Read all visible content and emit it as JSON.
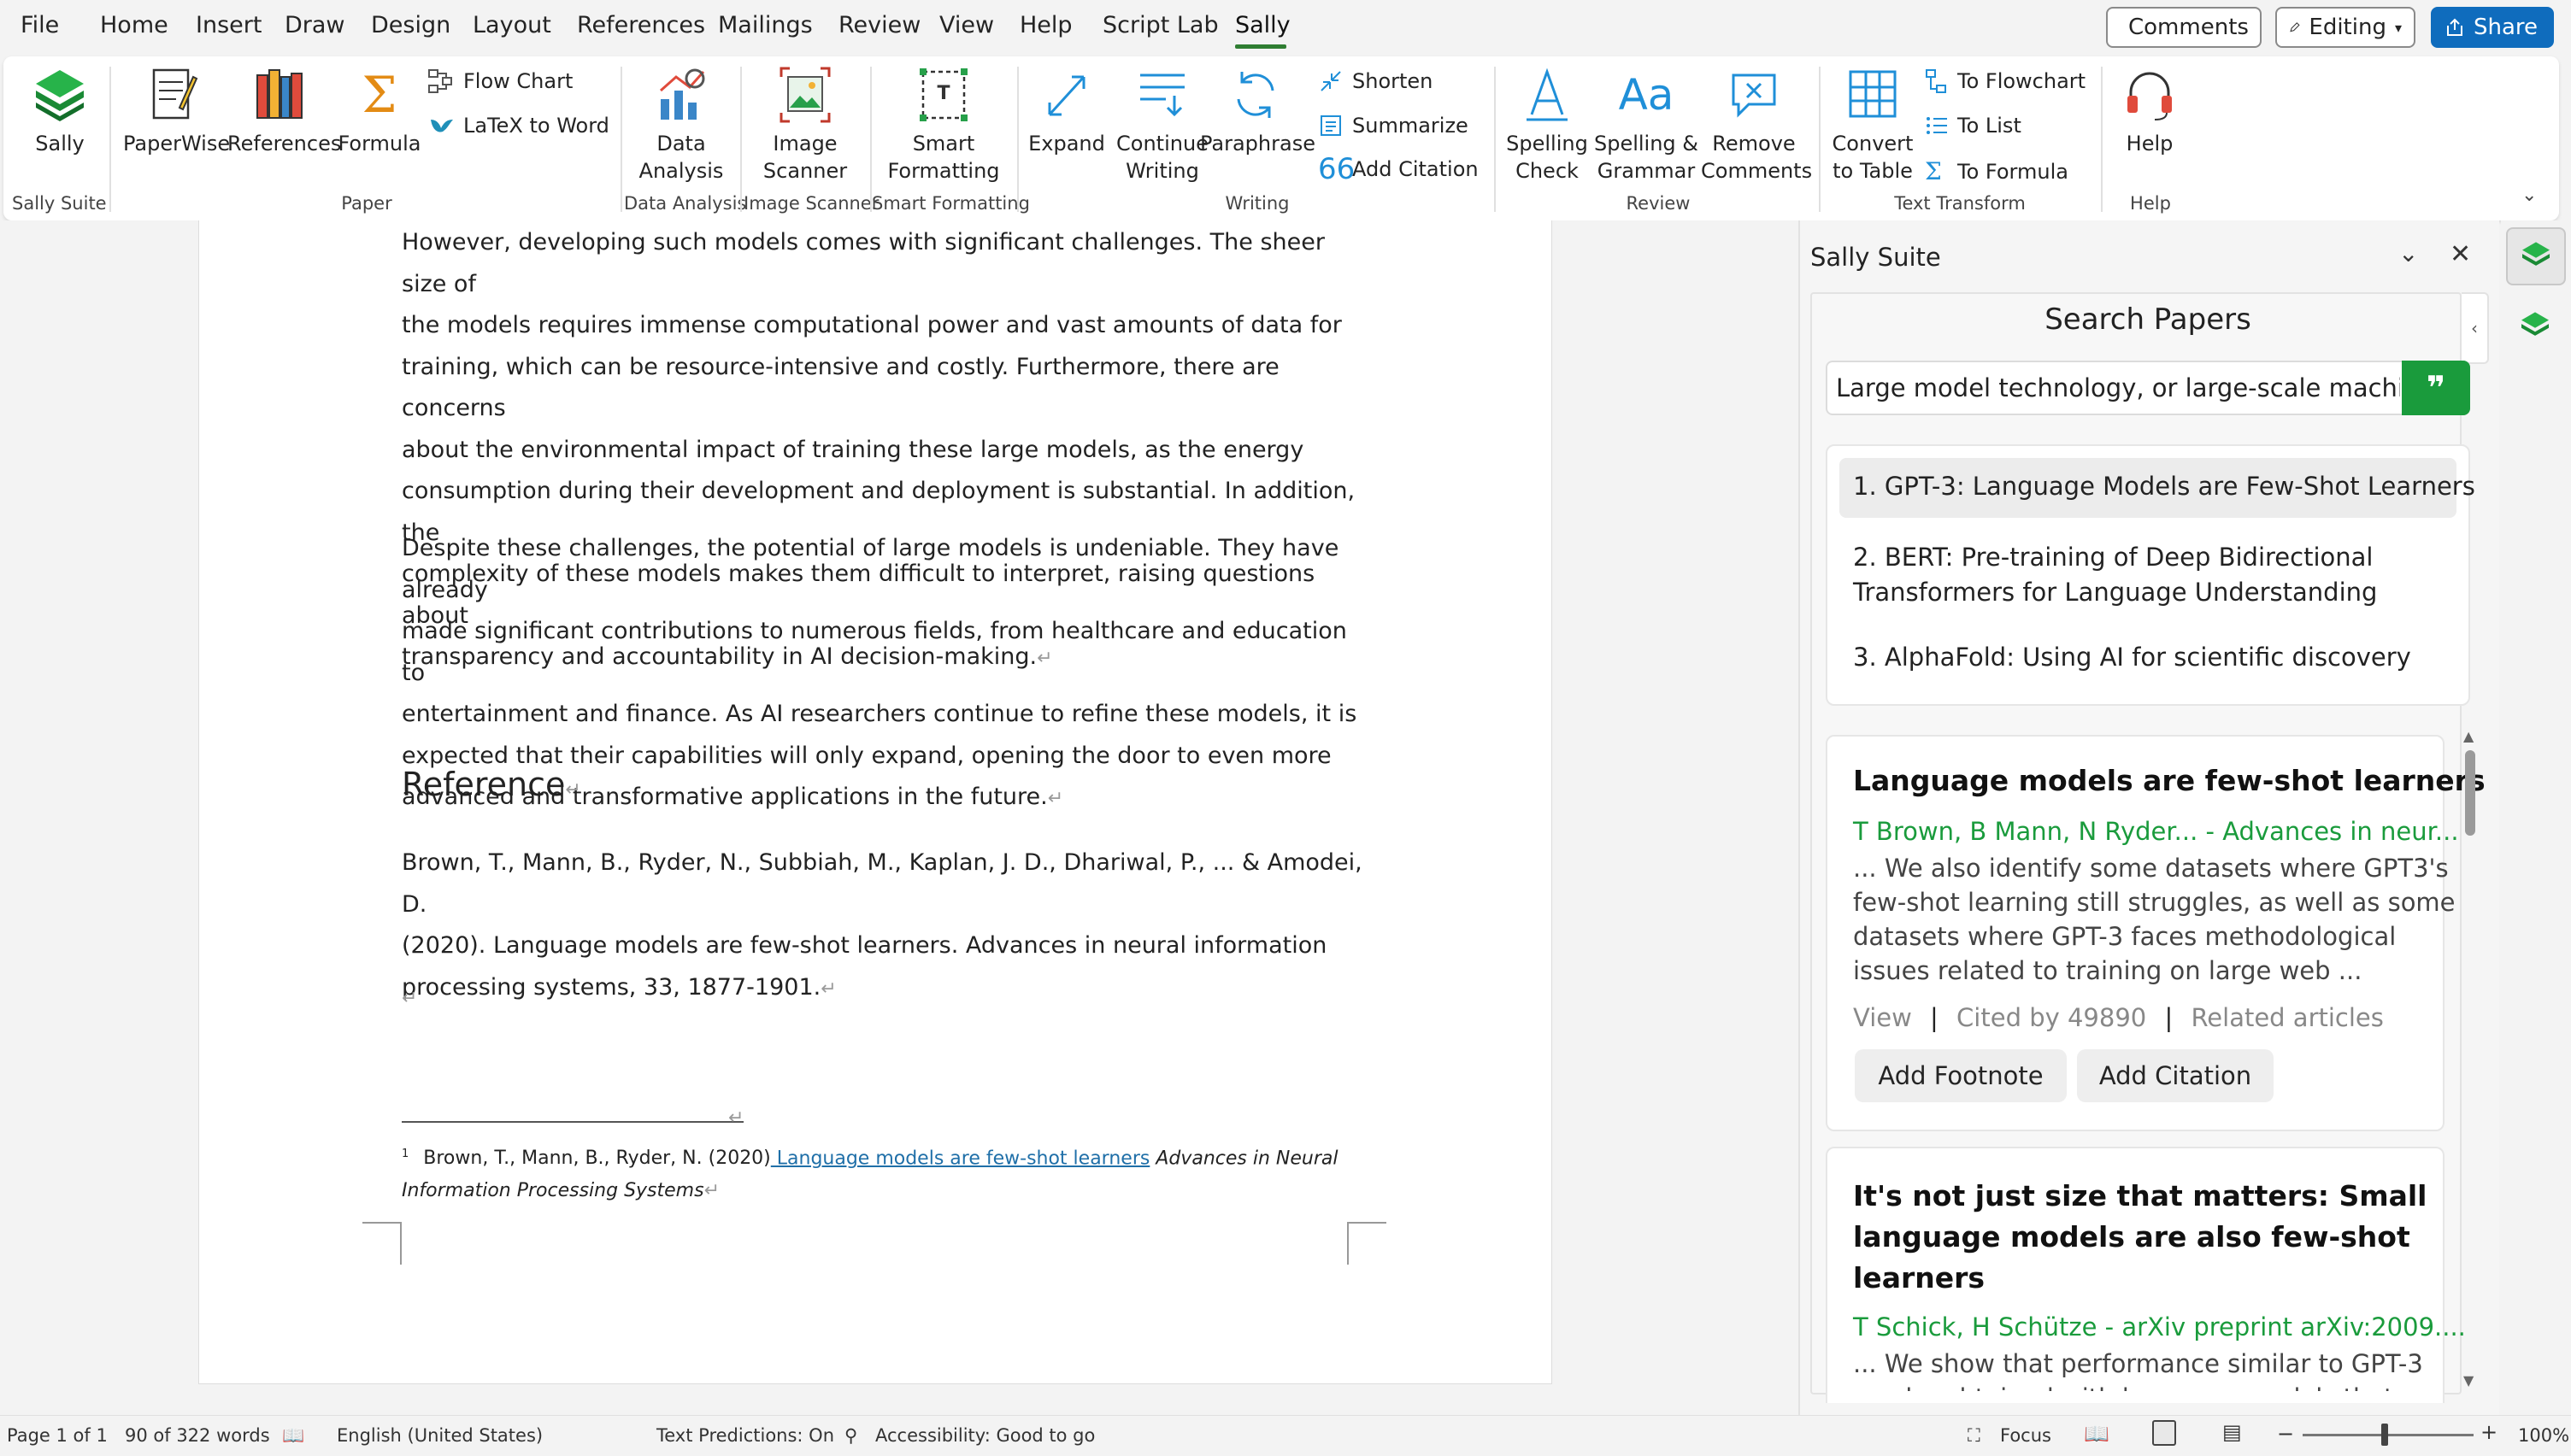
{
  "menubar": {
    "items": [
      "File",
      "Home",
      "Insert",
      "Draw",
      "Design",
      "Layout",
      "References",
      "Mailings",
      "Review",
      "View",
      "Help",
      "Script Lab",
      "Sally"
    ],
    "active": "Sally",
    "comments_label": "Comments",
    "editing_label": "Editing",
    "share_label": "Share"
  },
  "ribbon": {
    "groups": {
      "sally_suite": "Sally Suite",
      "paper": "Paper",
      "data_analysis": "Data Analysis",
      "image_scanner": "Image Scanner",
      "smart_formatting": "Smart Formatting",
      "writing": "Writing",
      "review": "Review",
      "text_transform": "Text Transform",
      "help": "Help"
    },
    "buttons": {
      "sally": "Sally",
      "paperwise": "PaperWise",
      "references": "References",
      "formula": "Formula",
      "flow_chart": "Flow Chart",
      "latex_to_word": "LaTeX to Word",
      "data_analysis_1": "Data",
      "data_analysis_2": "Analysis",
      "image_scanner_1": "Image",
      "image_scanner_2": "Scanner",
      "smart_formatting_1": "Smart",
      "smart_formatting_2": "Formatting",
      "expand": "Expand",
      "continue_writing_1": "Continue",
      "continue_writing_2": "Writing",
      "paraphrase": "Paraphrase",
      "shorten": "Shorten",
      "summarize": "Summarize",
      "add_citation": "Add Citation",
      "spelling_check_1": "Spelling",
      "spelling_check_2": "Check",
      "spelling_grammar_1": "Spelling &",
      "spelling_grammar_2": "Grammar",
      "remove_comments_1": "Remove",
      "remove_comments_2": "Comments",
      "convert_table_1": "Convert",
      "convert_table_2": "to Table",
      "to_flowchart": "To Flowchart",
      "to_list": "To List",
      "to_formula": "To Formula",
      "help": "Help"
    }
  },
  "document": {
    "paragraph1_lines": [
      "However, developing such models comes with significant challenges. The sheer size of",
      "the models requires immense computational power and vast amounts of data for",
      "training, which can be resource-intensive and costly. Furthermore, there are concerns",
      "about the environmental impact of training these large models, as the energy",
      "consumption during their development and deployment is substantial. In addition, the",
      "complexity of these models makes them difficult to interpret, raising questions about",
      "transparency and accountability in AI decision-making."
    ],
    "paragraph2_lines": [
      "Despite these challenges, the potential of large models is undeniable. They have already",
      "made significant contributions to numerous fields, from healthcare and education to",
      "entertainment and finance. As AI researchers continue to refine these models, it is",
      "expected that their capabilities will only expand, opening the door to even more",
      "advanced and transformative applications in the future."
    ],
    "reference_heading": "Reference",
    "reference_lines": [
      "Brown, T., Mann, B., Ryder, N., Subbiah, M., Kaplan, J. D., Dhariwal, P., ... & Amodei, D.",
      "(2020). Language models are few-shot learners. Advances in neural information",
      "processing systems, 33, 1877-1901."
    ],
    "footnote": {
      "marker": "1",
      "authors": "Brown, T., Mann, B., Ryder, N. (2020)",
      "link": " Language models are few-shot learners",
      "venue_line1": " Advances in Neural",
      "venue_line2": "Information Processing Systems"
    }
  },
  "panel": {
    "title": "Sally Suite",
    "section_title": "Search Papers",
    "search_value": "Large model technology, or large-scale machine",
    "suggestions": [
      "1. GPT-3: Language Models are Few-Shot Learners",
      "2. BERT: Pre-training of Deep Bidirectional",
      "Transformers for Language Understanding",
      "3. AlphaFold: Using AI for scientific discovery"
    ],
    "results": [
      {
        "title": "Language models are few-shot learners",
        "authors": "T Brown, B Mann, N Ryder... - Advances in neur...",
        "snippet_lines": [
          "... We also identify some datasets where GPT3's",
          "few-shot learning still struggles, as well as some",
          "datasets where GPT-3 faces methodological",
          "issues related to training on large web ..."
        ],
        "view": "View",
        "cited": "Cited by 49890",
        "related": "Related articles",
        "add_footnote": "Add Footnote",
        "add_citation": "Add Citation"
      },
      {
        "title_lines": [
          "It's not just size that matters: Small",
          "language models are also few-shot",
          "learners"
        ],
        "authors": "T Schick, H Schütze - arXiv preprint arXiv:2009....",
        "snippet_lines": [
          "... We show that performance similar to GPT-3",
          "can be obtained with language models that are"
        ]
      }
    ]
  },
  "statusbar": {
    "page": "Page 1 of 1",
    "words": "90 of 322 words",
    "language": "English (United States)",
    "predictions": "Text Predictions: On",
    "accessibility": "Accessibility: Good to go",
    "focus": "Focus",
    "zoom": "100%"
  },
  "colors": {
    "accent_green": "#1a9b3c",
    "link_blue": "#1f6fa8",
    "share_blue": "#0f6cbd"
  }
}
